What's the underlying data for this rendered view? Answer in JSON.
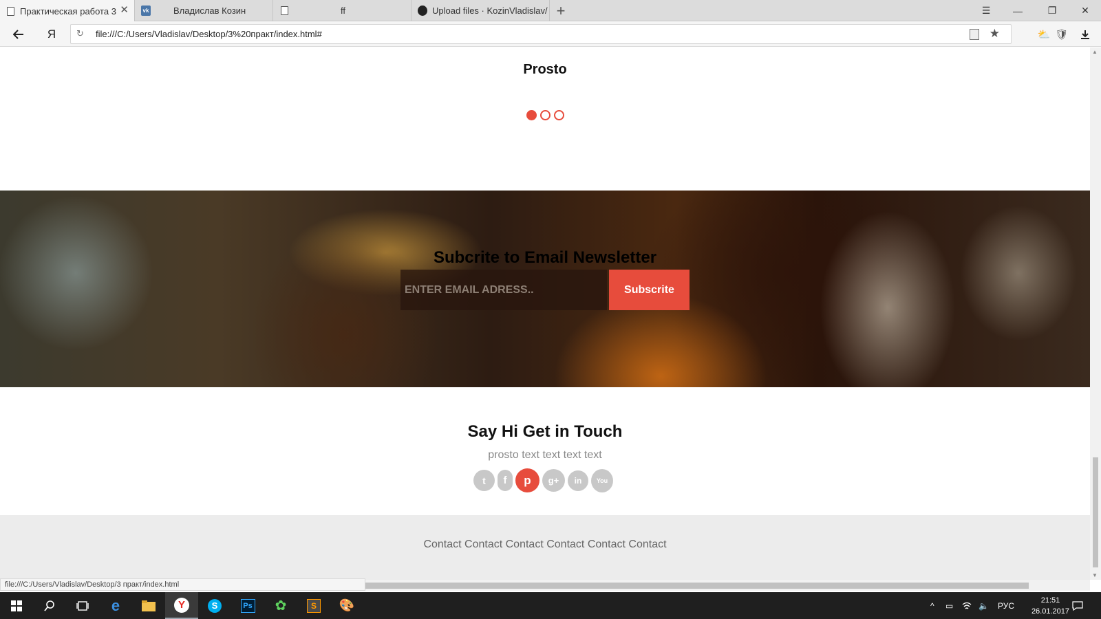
{
  "browser": {
    "tabs": [
      {
        "title": "Практическая работа 3",
        "icon": "document-icon",
        "active": true
      },
      {
        "title": "Владислав Козин",
        "icon": "vk-icon",
        "active": false
      },
      {
        "title": "ff",
        "icon": "document-icon",
        "active": false
      },
      {
        "title": "Upload files · KozinVladislav/",
        "icon": "github-icon",
        "active": false
      }
    ],
    "new_tab_glyph": "+",
    "address": "file:///C:/Users/Vladislav/Desktop/3%20практ/index.html#",
    "yandex_glyph": "Я"
  },
  "page": {
    "slider": {
      "title": "Prosto",
      "dots": [
        true,
        false,
        false
      ]
    },
    "newsletter": {
      "title": "Subcrite to Email Newsletter",
      "placeholder": "ENTER EMAIL ADRESS..",
      "button": "Subscrite"
    },
    "contact": {
      "title": "Say Hi Get in Touch",
      "subtitle": "prosto text text text text",
      "socials": [
        {
          "name": "twitter",
          "glyph": "t",
          "active": false
        },
        {
          "name": "facebook",
          "glyph": "f",
          "active": false
        },
        {
          "name": "pinterest",
          "glyph": "p",
          "active": true
        },
        {
          "name": "google-plus",
          "glyph": "g+",
          "active": false
        },
        {
          "name": "linkedin",
          "glyph": "in",
          "active": false
        },
        {
          "name": "youtube",
          "glyph": "You",
          "active": false
        }
      ]
    },
    "footer": {
      "links": [
        "Contact",
        "Contact",
        "Contact",
        "Contact",
        "Contact",
        "Contact"
      ]
    }
  },
  "status_url": "file:///C:/Users/Vladislav/Desktop/3 практ/index.html",
  "taskbar": {
    "language": "РУС",
    "time": "21:51",
    "date": "26.01.2017"
  },
  "colors": {
    "accent": "#e74c3c",
    "footer_bg": "#ececec",
    "taskbar_bg": "#1f1f1f"
  }
}
